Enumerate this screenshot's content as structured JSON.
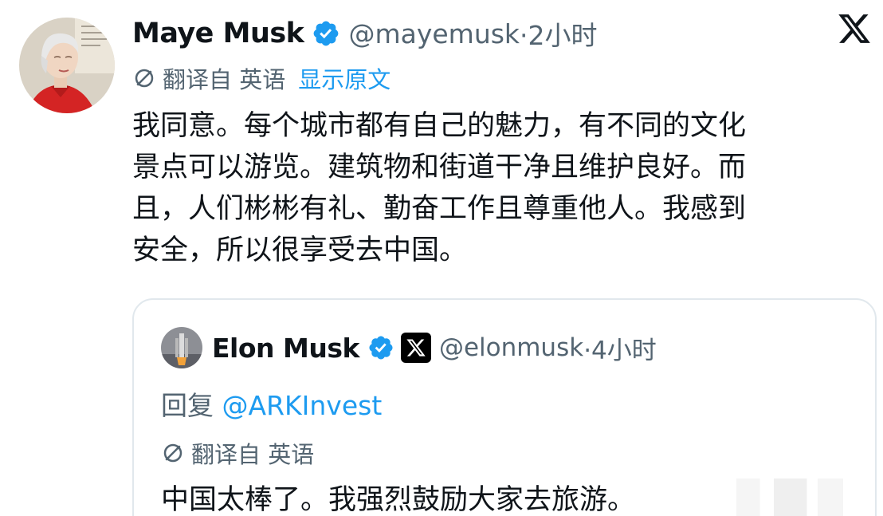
{
  "tweet": {
    "author_name": "Maye Musk",
    "handle": "@mayemusk",
    "time": "·2小时",
    "translate_label": "翻译自 英语",
    "show_original": "显示原文",
    "text_lines": [
      "我同意。每个城市都有自己的魅力，有不同的文化",
      "景点可以游览。建筑物和街道干净且维护良好。而",
      "且，人们彬彬有礼、勤奋工作且尊重他人。我感到",
      "安全，所以很享受去中国。"
    ]
  },
  "quoted_tweet": {
    "author_name": "Elon Musk",
    "handle": "@elonmusk",
    "time": "·4小时",
    "reply_prefix": "回复 ",
    "reply_mention": "@ARKInvest",
    "translate_label": "翻译自 英语",
    "text": "中国太棒了。我强烈鼓励大家去旅游。"
  },
  "icons": {
    "verified": "verified-badge-icon",
    "translate": "translate-icon",
    "brand": "x-logo-icon"
  },
  "colors": {
    "link": "#1d9bf0",
    "secondary_text": "#536471",
    "verified": "#1d9bf0",
    "primary_text": "#0f1419"
  }
}
